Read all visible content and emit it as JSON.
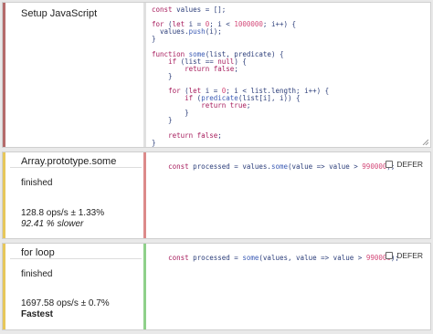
{
  "colors": {
    "setup_bar": "#b56b6b",
    "some_bar": "#e7c75a",
    "some_code_border": "#dc8a8a",
    "for_bar": "#e7c75a",
    "for_code_border": "#8fd08a"
  },
  "setup": {
    "label": "Setup JavaScript",
    "code": [
      "const values = [];",
      "",
      "for (let i = 0; i < 1000000; i++) {",
      "  values.push(i);",
      "}",
      "",
      "function some(list, predicate) {",
      "    if (list == null) {",
      "        return false;",
      "    }",
      "",
      "    for (let i = 0; i < list.length; i++) {",
      "        if (predicate(list[i], i)) {",
      "            return true;",
      "        }",
      "    }",
      "",
      "    return false;",
      "}"
    ]
  },
  "tests": [
    {
      "label": "Array.prototype.some",
      "status": "finished",
      "ops": "128.8 ops/s ± 1.33%",
      "comparison": "92.41 % slower",
      "code": "const processed = values.some(value => value > 990000);",
      "defer_label": "DEFER",
      "defer_checked": false
    },
    {
      "label": "for loop",
      "status": "finished",
      "ops": "1697.58 ops/s ± 0.7%",
      "comparison": "Fastest",
      "code": "const processed = some(values, value => value > 990000);",
      "defer_label": "DEFER",
      "defer_checked": false
    }
  ]
}
